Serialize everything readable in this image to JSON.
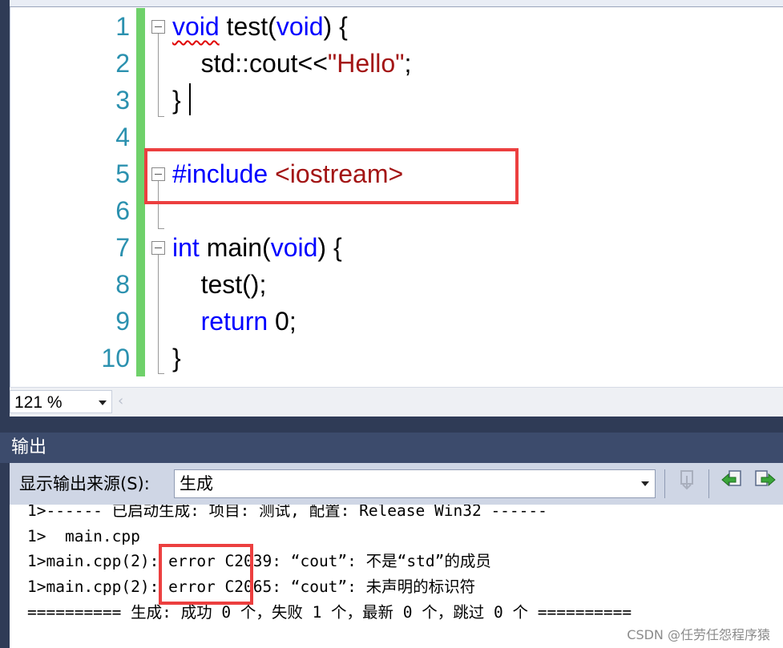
{
  "editor": {
    "line_numbers": [
      "1",
      "2",
      "3",
      "4",
      "5",
      "6",
      "7",
      "8",
      "9",
      "10"
    ],
    "lines": [
      [
        {
          "t": "void",
          "k": "kw",
          "squiggle": true
        },
        {
          "t": " test(",
          "k": ""
        },
        {
          "t": "void",
          "k": "kw"
        },
        {
          "t": ") {",
          "k": ""
        }
      ],
      [
        {
          "t": "    std::cout<<",
          "k": ""
        },
        {
          "t": "\"Hello\"",
          "k": "str"
        },
        {
          "t": ";",
          "k": ""
        }
      ],
      [
        {
          "t": "}",
          "k": ""
        }
      ],
      [],
      [
        {
          "t": "#include ",
          "k": "kw"
        },
        {
          "t": "<iostream>",
          "k": "str"
        }
      ],
      [],
      [
        {
          "t": "int",
          "k": "kw"
        },
        {
          "t": " main(",
          "k": ""
        },
        {
          "t": "void",
          "k": "kw"
        },
        {
          "t": ") {",
          "k": ""
        }
      ],
      [
        {
          "t": "    test();",
          "k": ""
        }
      ],
      [
        {
          "t": "    ",
          "k": ""
        },
        {
          "t": "return",
          "k": "kw"
        },
        {
          "t": " 0;",
          "k": ""
        }
      ],
      [
        {
          "t": "}",
          "k": ""
        }
      ]
    ],
    "zoom_value": "121 %"
  },
  "output_panel": {
    "title": "输出",
    "source_label": "显示输出来源(S):",
    "source_value": "生成",
    "lines": [
      "1>------ 已启动生成: 项目: 测试, 配置: Release Win32 ------",
      "1>  main.cpp",
      "1>main.cpp(2): error C2039: “cout”: 不是“std”的成员",
      "1>main.cpp(2): error C2065: “cout”: 未声明的标识符",
      "========== 生成: 成功 0 个，失败 1 个，最新 0 个，跳过 0 个 =========="
    ]
  },
  "watermark": "CSDN @任劳任怨程序猿",
  "colors": {
    "keyword": "#0000ff",
    "string": "#a31515",
    "line_number": "#2b91af",
    "change_bar": "#6fd16a",
    "highlight_box": "#ec3f3f",
    "panel_header": "#3c4b6c"
  },
  "icons": [
    "dropdown-arrow-icon",
    "scroll-left-icon",
    "go-to-location-icon",
    "previous-message-icon",
    "next-message-icon"
  ]
}
